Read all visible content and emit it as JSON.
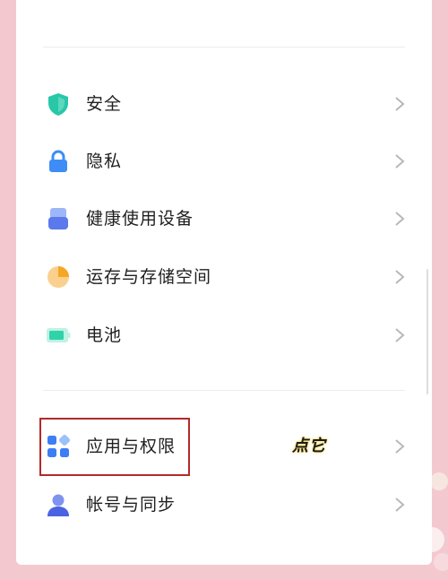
{
  "settings": {
    "items": [
      {
        "label": "安全",
        "icon": "shield-icon"
      },
      {
        "label": "隐私",
        "icon": "lock-icon"
      },
      {
        "label": "健康使用设备",
        "icon": "device-usage-icon"
      },
      {
        "label": "运存与存储空间",
        "icon": "storage-pie-icon"
      },
      {
        "label": "电池",
        "icon": "battery-icon"
      },
      {
        "label": "应用与权限",
        "icon": "apps-icon"
      },
      {
        "label": "帐号与同步",
        "icon": "account-icon"
      }
    ]
  },
  "annotation": {
    "text": "点它",
    "highlighted_item": "应用与权限"
  },
  "colors": {
    "accent_red": "#b22a2a",
    "shield": "#28c7a8",
    "lock": "#3e8df7",
    "apps": "#3e7ef5",
    "pie": "#f5a623",
    "battery": "#2fd3a7"
  }
}
